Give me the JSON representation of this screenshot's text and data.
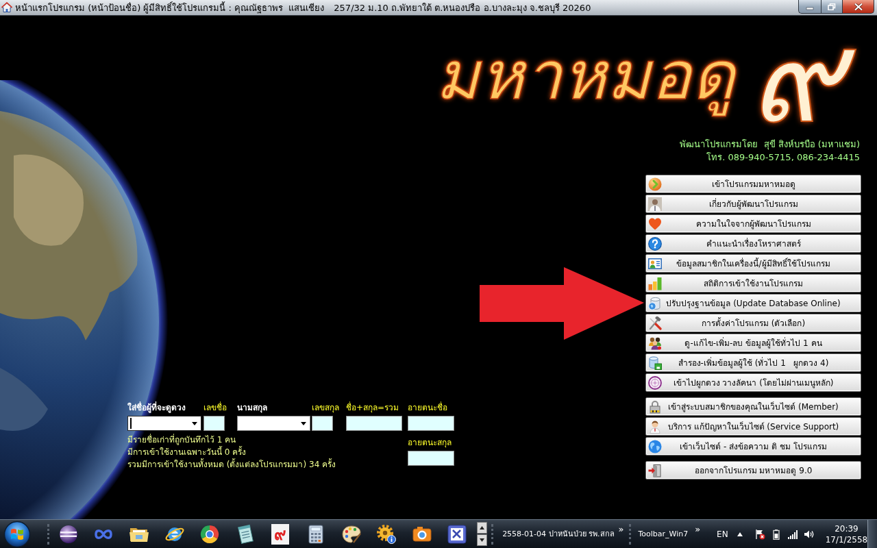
{
  "window": {
    "title": "หน้าแรกโปรแกรม (หน้าป้อนชื่อ) ผู้มีสิทธิ์ใช้โปรแกรมนี้ : คุณณัฐธาพร  แสนเชียง",
    "address": "257/32 ม.10 ถ.พัทยาใต้ ต.หนองปรือ อ.บางละมุง จ.ชลบุรี 20260"
  },
  "logo": {
    "name": "มหาหมอดู",
    "numeral": "๙"
  },
  "developer": {
    "credit": "พัฒนาโปรแกรมโดย  สุขี สิงห์บรบือ (มหาแชม)",
    "phone": "โทร. 089-940-5715, 086-234-4415"
  },
  "menu": {
    "groups": [
      {
        "items": [
          {
            "label": "เข้าโปรแกรมมหาหมอดู"
          },
          {
            "label": "เกี่ยวกับผู้พัฒนาโปรแกรม"
          },
          {
            "label": "ความในใจจากผู้พัฒนาโปรแกรม"
          },
          {
            "label": "คำแนะนำเรื่องโหราศาสตร์"
          },
          {
            "label": "ข้อมูลสมาชิกในเครื่องนี้/ผู้มีสิทธิ์ใช้โปรแกรม"
          },
          {
            "label": "สถิติการเข้าใช้งานโปรแกรม"
          },
          {
            "label": "ปรับปรุงฐานข้อมูล (Update Database Online)"
          },
          {
            "label": "การตั้งค่าโปรแกรม (ตัวเลือก)"
          },
          {
            "label": "ดู-แก้ไข-เพิ่ม-ลบ ข้อมูลผู้ใช้ทั่วไป 1 คน"
          },
          {
            "label": "สำรอง-เพิ่มข้อมูลผู้ใช้ (ทั่วไป 1   ผูกดวง 4)"
          },
          {
            "label": "เข้าไปผูกดวง วางลัคนา (โดยไม่ผ่านเมนูหลัก)"
          }
        ]
      },
      {
        "items": [
          {
            "label": "เข้าสู่ระบบสมาชิกของคุณในเว็บไซต์ (Member)"
          },
          {
            "label": "บริการ แก้ปัญหาในเว็บไซต์ (Service Support)"
          },
          {
            "label": "เข้าเว็บไซต์ - ส่งข้อความ ติ ชม โปรแกรม"
          }
        ]
      },
      {
        "items": [
          {
            "label": "ออกจากโปรแกรม มหาหมอดู 9.0"
          }
        ]
      }
    ]
  },
  "form": {
    "fields": [
      {
        "label": "ใส่ชื่อผู้ที่จะดูดวง",
        "kind": "combo",
        "focused": true
      },
      {
        "label": "เลขชื่อ",
        "kind": "box",
        "focused": false
      },
      {
        "label": "นามสกุล",
        "kind": "combo",
        "focused": false
      },
      {
        "label": "เลขสกุล",
        "kind": "box",
        "focused": false
      },
      {
        "label": "ชื่อ+สกุล=รวม",
        "kind": "box",
        "focused": false
      },
      {
        "label": "อายตนะชื่อ",
        "kind": "box",
        "focused": false
      }
    ],
    "stats": [
      "มีรายชื่อเก่าที่ถูกบันทึกไว้ 1 คน",
      "มีการเข้าใช้งานเฉพาะวันนี้ 0 ครั้ง",
      "รวมมีการเข้าใช้งานทั้งหมด (ตั้งแต่ลงโปรแกรมมา) 34 ครั้ง"
    ],
    "side_field": {
      "label": "อายตนะสกุล",
      "kind": "box",
      "focused": false
    }
  },
  "taskbar": {
    "app_glyph": "๙",
    "toolbars": [
      {
        "label": "2558-01-04 ปาหนันป่วย รพ.สกล",
        "chevron": "»"
      },
      {
        "label": "Toolbar_Win7",
        "chevron": "»"
      }
    ],
    "language": "EN",
    "clock": {
      "time": "20:39",
      "date": "17/1/2558"
    }
  }
}
